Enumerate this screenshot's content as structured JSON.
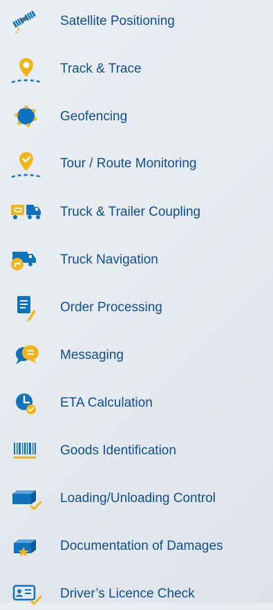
{
  "colors": {
    "text": "#0f4f8f",
    "primary": "#0e73bc",
    "accent": "#f1b51c"
  },
  "features": [
    {
      "label": "Satellite Positioning",
      "icon": "satellite-icon"
    },
    {
      "label": "Track & Trace",
      "icon": "location-pin-route-icon"
    },
    {
      "label": "Geofencing",
      "icon": "geofence-polygon-icon"
    },
    {
      "label": "Tour / Route Monitoring",
      "icon": "route-checkmark-pin-icon"
    },
    {
      "label": "Truck & Trailer Coupling",
      "icon": "truck-trailer-coupling-icon"
    },
    {
      "label": "Truck Navigation",
      "icon": "truck-navigation-icon"
    },
    {
      "label": "Order Processing",
      "icon": "order-document-pencil-icon"
    },
    {
      "label": "Messaging",
      "icon": "message-bubbles-icon"
    },
    {
      "label": "ETA Calculation",
      "icon": "eta-clock-check-icon"
    },
    {
      "label": "Goods Identification",
      "icon": "barcode-icon"
    },
    {
      "label": "Loading/Unloading Control",
      "icon": "cargo-box-check-icon"
    },
    {
      "label": "Documentation of Damages",
      "icon": "damaged-box-icon"
    },
    {
      "label": "Driver’s Licence Check",
      "icon": "driver-licence-check-icon"
    }
  ]
}
